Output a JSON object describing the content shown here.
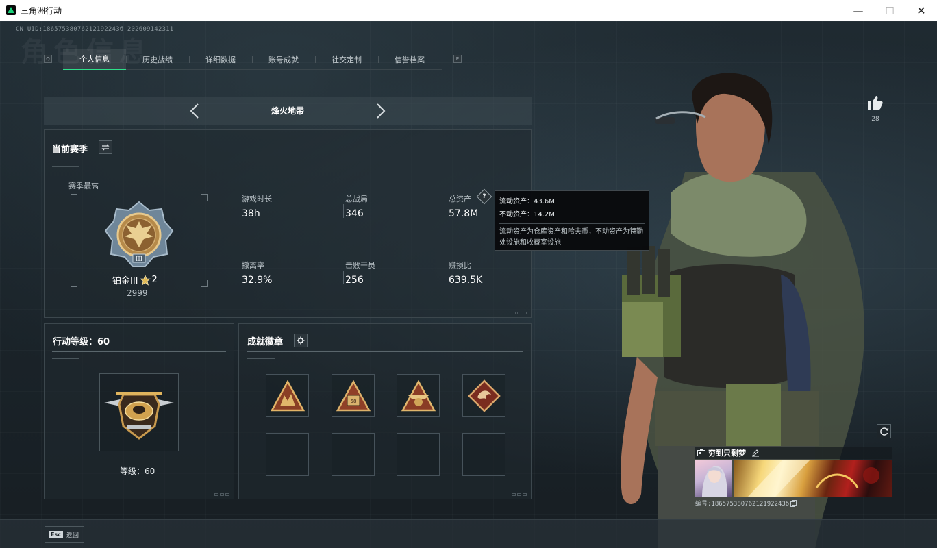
{
  "window": {
    "title": "三角洲行动",
    "minimize": "—",
    "maximize": "☐",
    "close": "✕"
  },
  "header": {
    "uid": "CN UID:18657538076212192243б_202609142311",
    "watermark": "角色信息",
    "left_key": "Q",
    "right_key": "E"
  },
  "tabs": [
    {
      "label": "个人信息",
      "active": true
    },
    {
      "label": "历史战绩",
      "active": false
    },
    {
      "label": "详细数据",
      "active": false
    },
    {
      "label": "账号成就",
      "active": false
    },
    {
      "label": "社交定制",
      "active": false
    },
    {
      "label": "信誉档案",
      "active": false
    }
  ],
  "mode": {
    "title": "烽火地带"
  },
  "season": {
    "title": "当前赛季",
    "best_label": "赛季最高",
    "rank_name": "铂金III",
    "rank_stars": "2",
    "rank_score": "2999",
    "stats": [
      {
        "label": "游戏时长",
        "value": "38h"
      },
      {
        "label": "总战局",
        "value": "346"
      },
      {
        "label": "总资产",
        "value": "57.8M"
      },
      {
        "label": "撤离率",
        "value": "32.9%"
      },
      {
        "label": "击败干员",
        "value": "256"
      },
      {
        "label": "赚损比",
        "value": "639.5K"
      }
    ]
  },
  "tooltip": {
    "liquid": "流动资产：43.6M",
    "fixed": "不动资产：14.2M",
    "note": "流动资产为仓库资产和哈夫币，不动资产为特勤处设施和收藏室设施"
  },
  "level": {
    "title": "行动等级：60",
    "caption": "等级：60"
  },
  "achievements": {
    "title": "成就徽章",
    "badges": [
      "badge-soldiers",
      "badge-58",
      "badge-eagle",
      "badge-dragon"
    ]
  },
  "profile": {
    "likes": "28",
    "player_name": "穷到只剩梦",
    "id_text": "编号:18657538076212192243б"
  },
  "footer": {
    "esc_key": "Esc",
    "esc_label": "返回"
  },
  "colors": {
    "accent": "#2ee08a",
    "gold": "#c89a4b",
    "panel_border": "#3c474d"
  }
}
